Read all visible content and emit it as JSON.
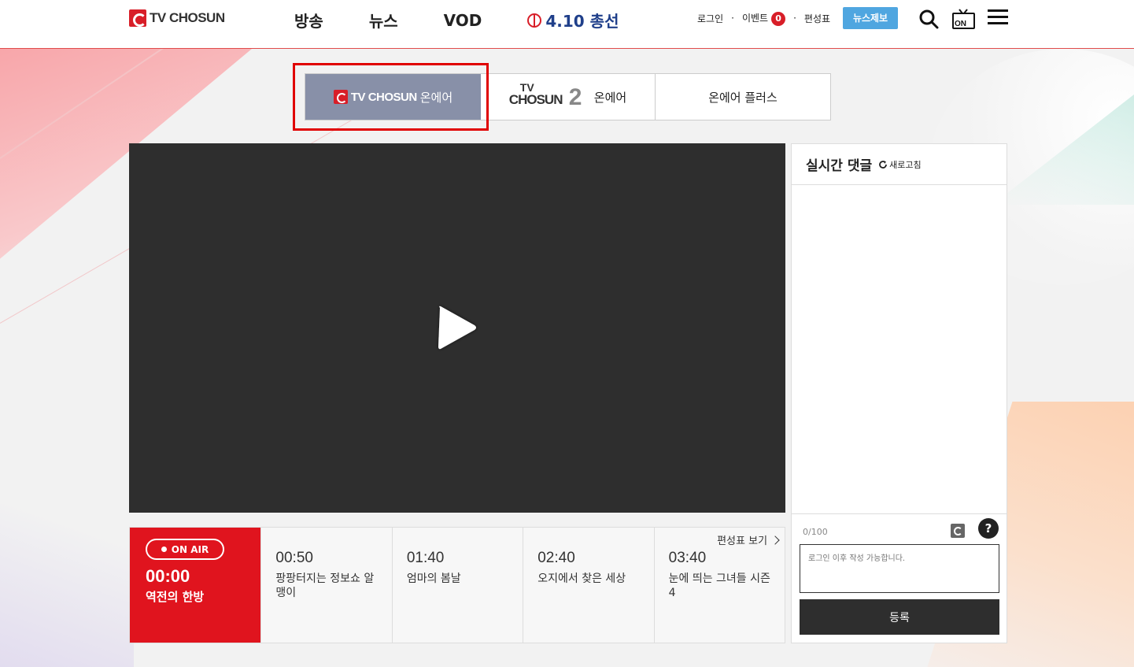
{
  "header": {
    "logo_text": "TV CHOSUN",
    "nav": [
      "방송",
      "뉴스",
      "VOD"
    ],
    "election_label": "4.10 총선",
    "login": "로그인",
    "event": "이벤트",
    "event_count": "0",
    "schedule": "편성표",
    "news_report": "뉴스제보",
    "icons": [
      "search-icon",
      "tv-on-icon",
      "menu-icon"
    ]
  },
  "tabs": {
    "tab1_logo": "TV CHOSUN",
    "tab1_suffix": "온에어",
    "tab2_logo_tv": "TV",
    "tab2_logo_chosun": "CHOSUN",
    "tab2_logo_2": "2",
    "tab2_suffix": "온에어",
    "tab3": "온에어 플러스"
  },
  "schedule": {
    "onair_badge": "ON AIR",
    "now_time": "00:00",
    "now_title": "역전의 한방",
    "link": "편성표 보기",
    "slots": [
      {
        "time": "00:50",
        "title": "팡팡터지는 정보쇼 알맹이"
      },
      {
        "time": "01:40",
        "title": "엄마의 봄날"
      },
      {
        "time": "02:40",
        "title": "오지에서 찾은 세상"
      },
      {
        "time": "03:40",
        "title": "눈에 띄는 그녀들 시즌4"
      }
    ]
  },
  "comments": {
    "title": "실시간 댓글",
    "refresh": "새로고침",
    "counter": "0/100",
    "placeholder": "로그인 이후 작성 가능합니다.",
    "submit": "등록"
  },
  "colors": {
    "brand_red": "#e0141e",
    "active_tab": "#8890a8",
    "report_blue": "#4fa6e0",
    "player_bg": "#2e2e2e"
  }
}
